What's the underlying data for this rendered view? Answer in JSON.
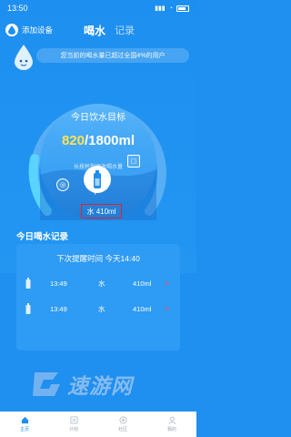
{
  "status_bar": {
    "time": "13:50"
  },
  "header": {
    "device_label": "添加设备",
    "tabs": [
      {
        "label": "喝水",
        "active": true
      },
      {
        "label": "记录",
        "active": false
      }
    ]
  },
  "notice": "您当前的喝水量已超过全国4%的用户",
  "goal": {
    "title": "今日饮水目标",
    "current": "820",
    "total": "/1800ml",
    "hint": "长按杯型更改喝水量",
    "progress_fraction": 0.456
  },
  "drink_button": {
    "label": "水 410ml",
    "plus": "+"
  },
  "records": {
    "title": "今日喝水记录",
    "reminder": "下次提醒时间 今天14:40",
    "rows": [
      {
        "time": "13:49",
        "type": "水",
        "amount": "410ml",
        "delete": "×"
      },
      {
        "time": "13:49",
        "type": "水",
        "amount": "410ml",
        "delete": "×"
      }
    ]
  },
  "watermark": "速游网",
  "nav": [
    {
      "label": "主页",
      "icon": "home-icon",
      "active": true
    },
    {
      "label": "计划",
      "icon": "plan-icon",
      "active": false
    },
    {
      "label": "社区",
      "icon": "community-icon",
      "active": false
    },
    {
      "label": "我的",
      "icon": "profile-icon",
      "active": false
    }
  ],
  "colors": {
    "primary": "#1f8ff0",
    "highlight": "#ffe34d",
    "delete": "#ff4b5c",
    "selection_box": "#e0242a"
  }
}
